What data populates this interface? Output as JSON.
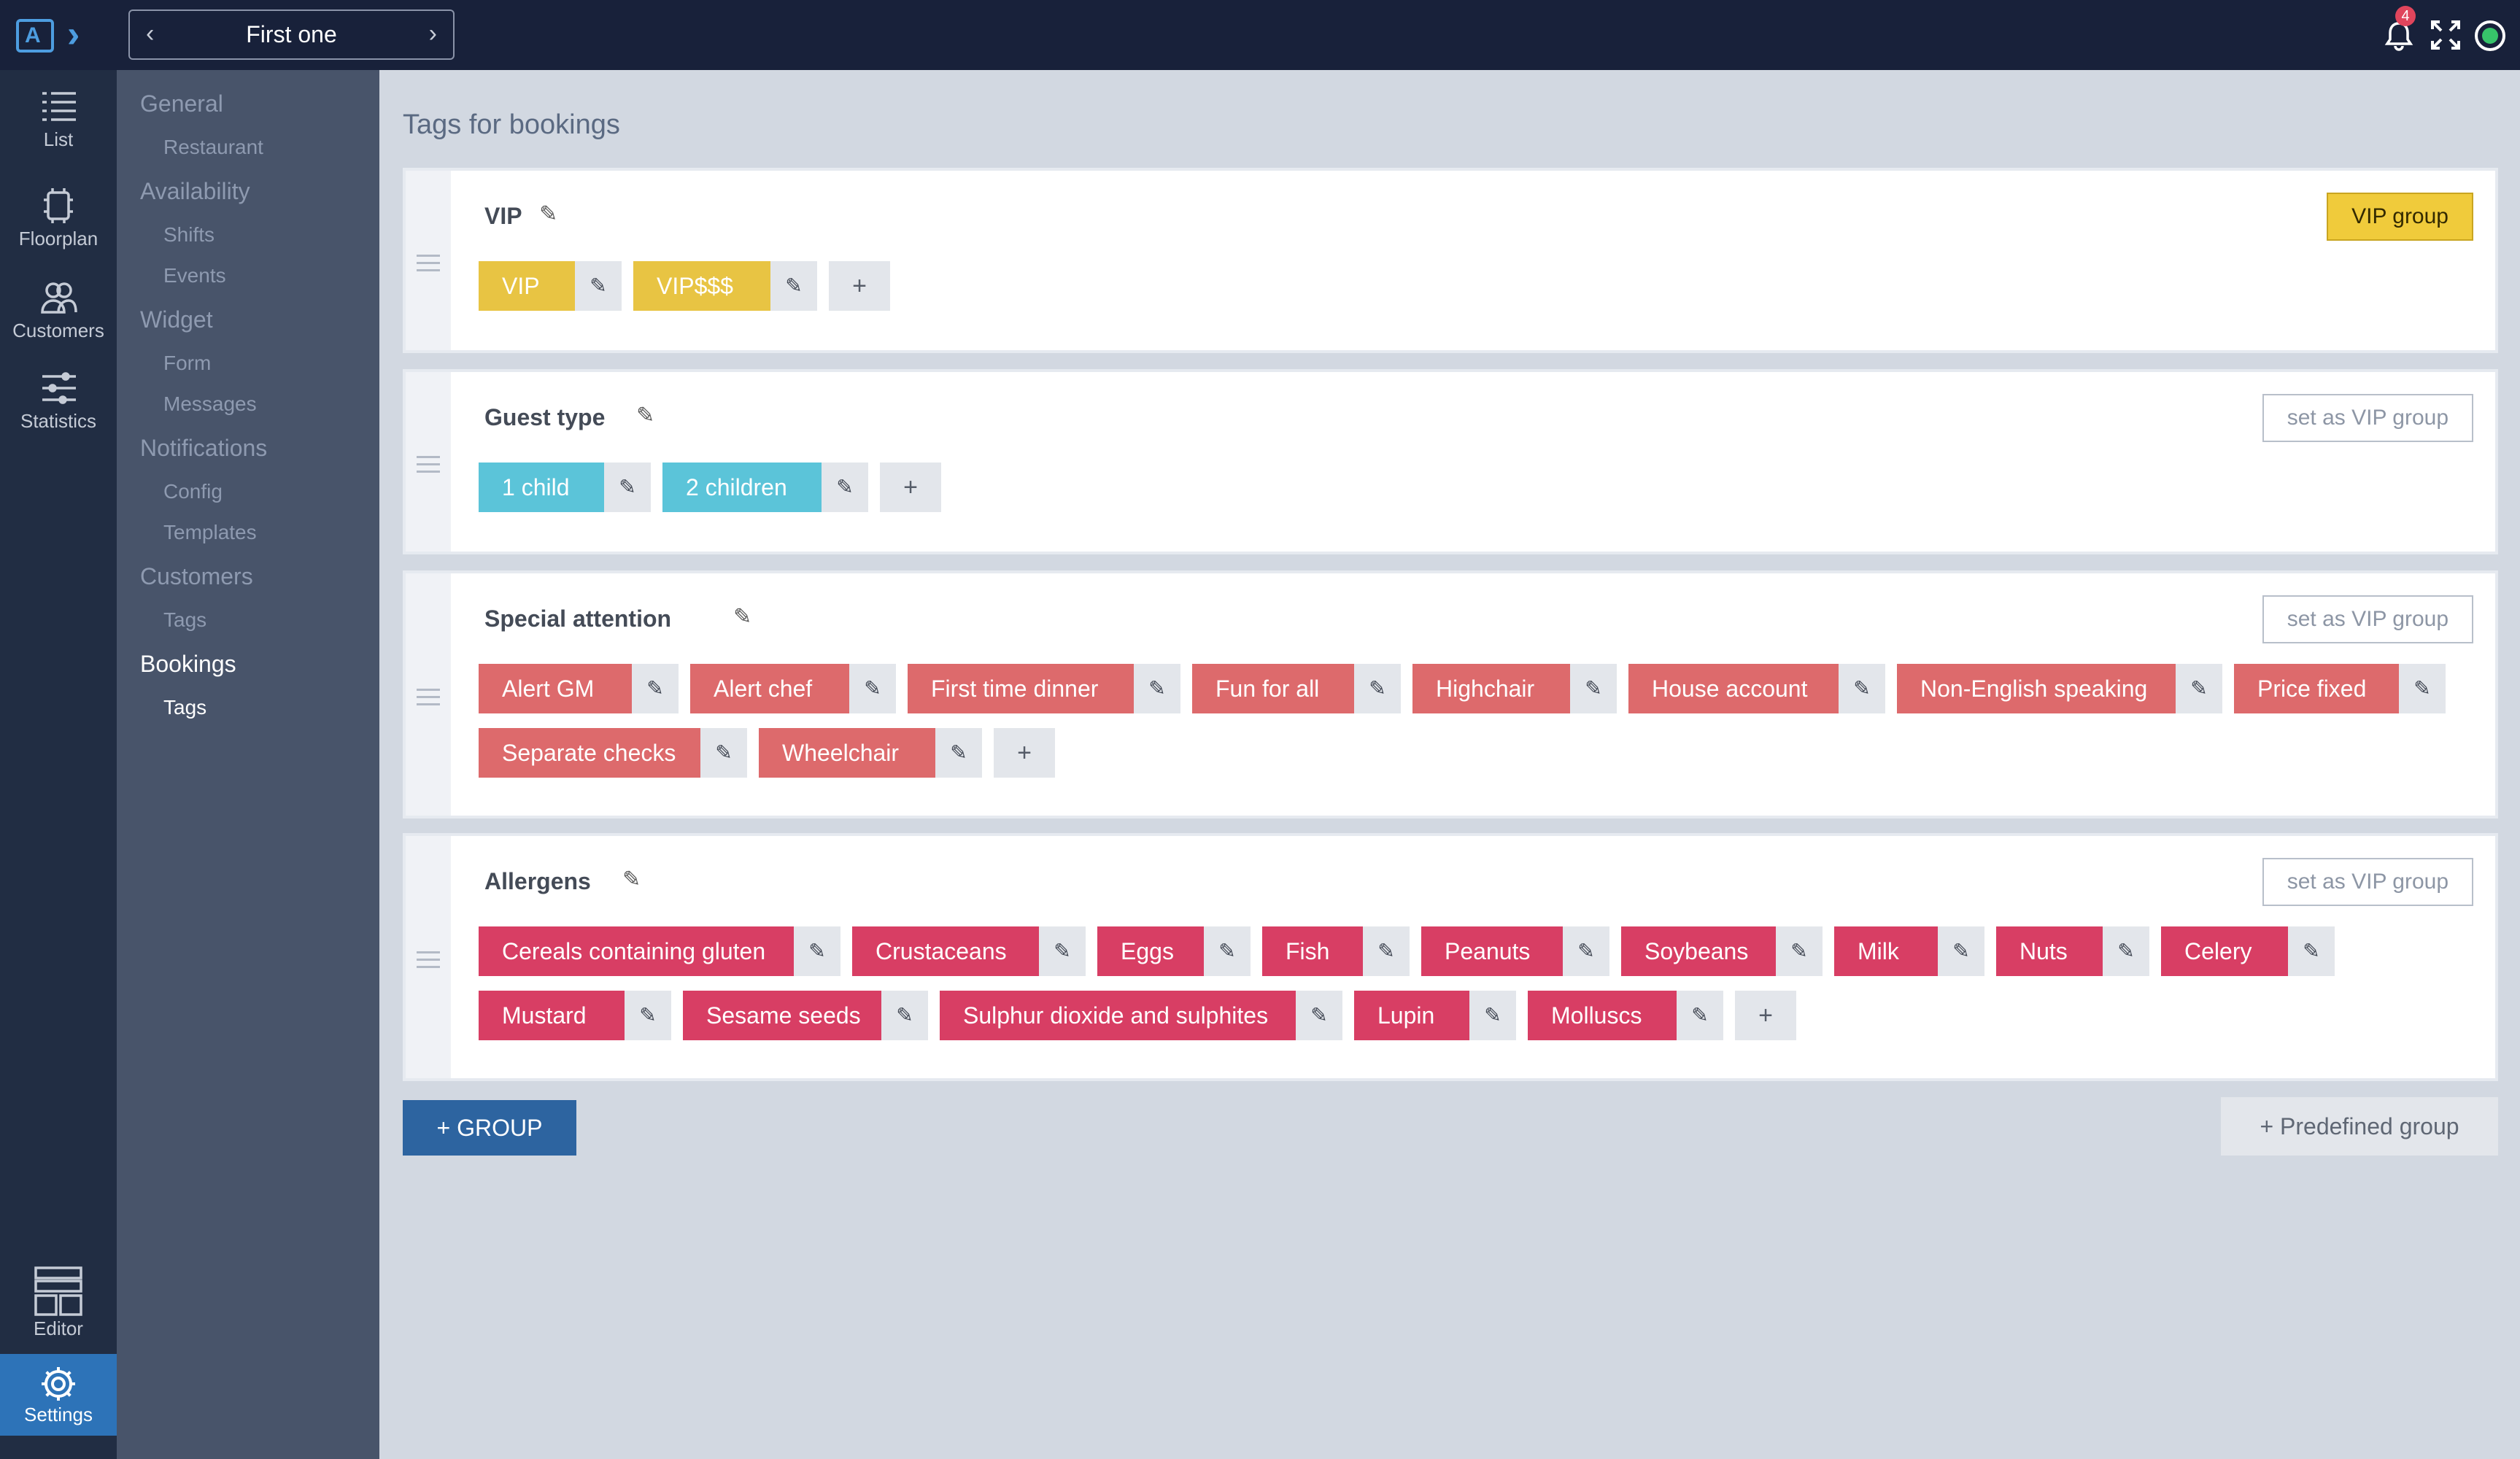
{
  "topbar": {
    "logo_letter": "A",
    "picker_value": "First one",
    "prev_arrow": "‹",
    "next_arrow": "›",
    "notification_count": "4"
  },
  "rail": {
    "items": [
      {
        "label": "List",
        "icon": "list-icon"
      },
      {
        "label": "Floorplan",
        "icon": "floorplan-icon"
      },
      {
        "label": "Customers",
        "icon": "customers-icon"
      },
      {
        "label": "Statistics",
        "icon": "statistics-icon"
      },
      {
        "label": "Editor",
        "icon": "editor-icon"
      },
      {
        "label": "Settings",
        "icon": "gear-icon"
      }
    ]
  },
  "settings_nav": {
    "sections": [
      {
        "title": "General",
        "items": [
          "Restaurant"
        ]
      },
      {
        "title": "Availability",
        "items": [
          "Shifts",
          "Events"
        ]
      },
      {
        "title": "Widget",
        "items": [
          "Form",
          "Messages"
        ]
      },
      {
        "title": "Notifications",
        "items": [
          "Config",
          "Templates"
        ]
      },
      {
        "title": "Customers",
        "items": [
          "Tags"
        ]
      },
      {
        "title": "Bookings",
        "items": [
          "Tags"
        ]
      }
    ],
    "active_section": "Bookings",
    "active_item": "Tags"
  },
  "main": {
    "title": "Tags for bookings",
    "groups": [
      {
        "name": "VIP",
        "vip_button": "VIP group",
        "is_vip": true,
        "color": "#e8c443",
        "tags": [
          "VIP",
          "VIP$$$"
        ]
      },
      {
        "name": "Guest type",
        "vip_button": "set as VIP group",
        "is_vip": false,
        "color": "#5bc4d9",
        "tags": [
          "1 child",
          "2 children"
        ]
      },
      {
        "name": "Special attention",
        "vip_button": "set as VIP group",
        "is_vip": false,
        "color": "#dd6a6c",
        "tags": [
          "Alert GM",
          "Alert chef",
          "First time dinner",
          "Fun for all",
          "Highchair",
          "House account",
          "Non-English speaking",
          "Price fixed",
          "Separate checks",
          "Wheelchair"
        ]
      },
      {
        "name": "Allergens",
        "vip_button": "set as VIP group",
        "is_vip": false,
        "color": "#d83e64",
        "tags": [
          "Cereals containing gluten",
          "Crustaceans",
          "Eggs",
          "Fish",
          "Peanuts",
          "Soybeans",
          "Milk",
          "Nuts",
          "Celery",
          "Mustard",
          "Sesame seeds",
          "Sulphur dioxide and sulphites",
          "Lupin",
          "Molluscs"
        ]
      }
    ],
    "add_tag_label": "+",
    "add_group_label": "+ GROUP",
    "predefined_group_label": "+ Predefined group"
  }
}
